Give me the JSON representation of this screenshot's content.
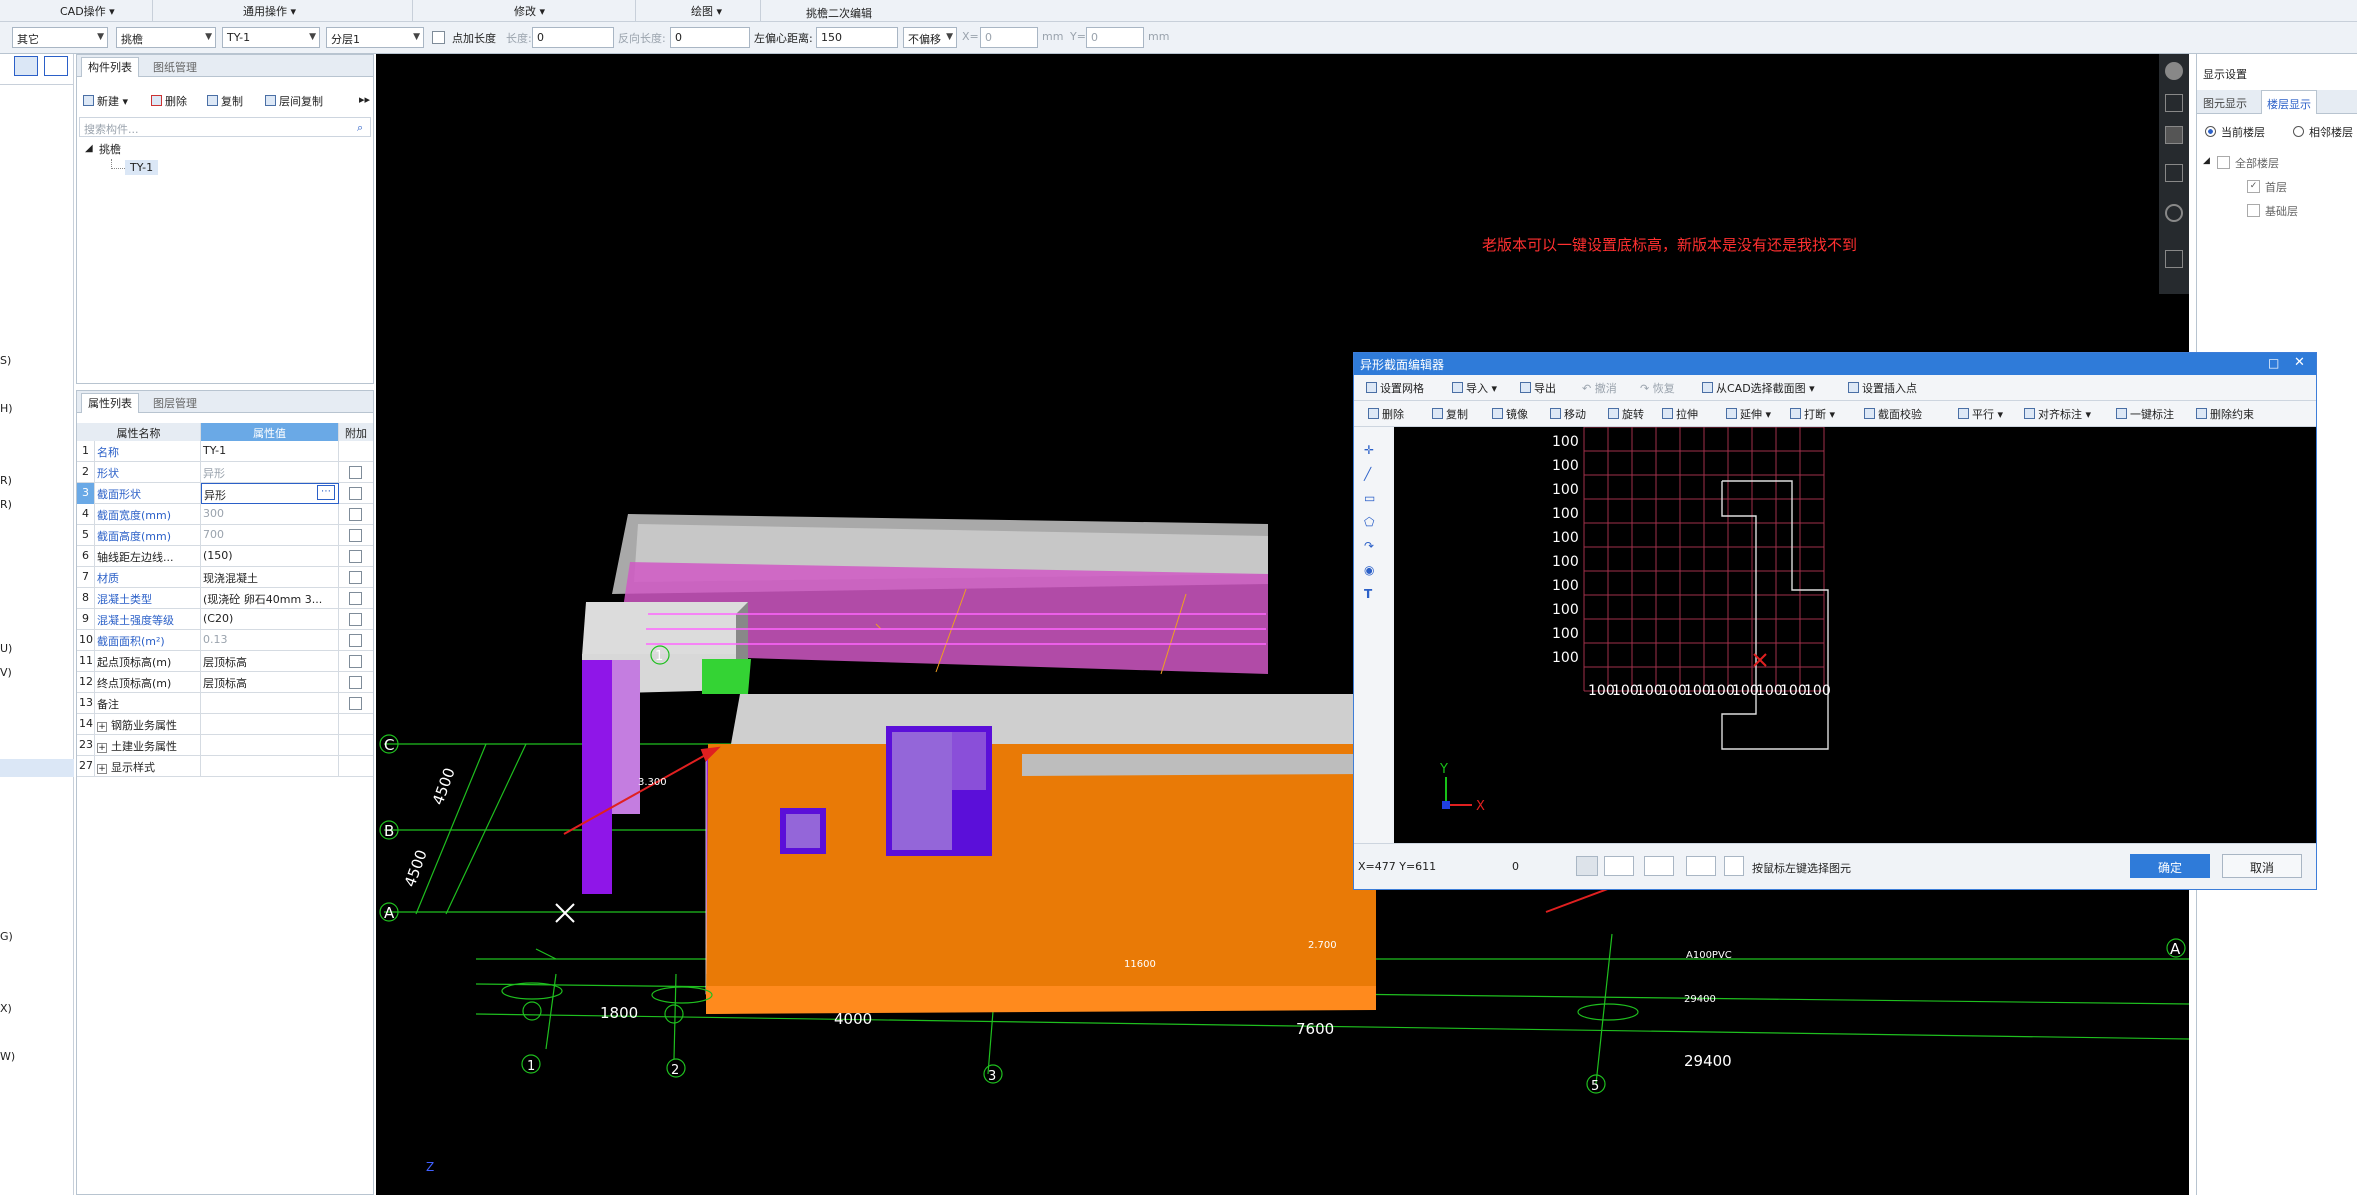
{
  "ribbon": {
    "groups": [
      "CAD操作",
      "通用操作",
      "修改",
      "绘图",
      "挑檐二次编辑"
    ]
  },
  "toolbar": {
    "type_select": "其它",
    "category_select": "挑檐",
    "component_select": "TY-1",
    "layer_select": "分层1",
    "point_length_label": "点加长度",
    "length_label": "长度:",
    "length_value": "0",
    "reverse_length_label": "反向长度:",
    "reverse_length_value": "0",
    "left_offset_label": "左偏心距离:",
    "left_offset_value": "150",
    "offset_mode_select": "不偏移",
    "x_label": "X=",
    "x_value": "0",
    "y_label": "Y=",
    "y_value": "0",
    "unit_mm": "mm"
  },
  "left_strip": {
    "labels": [
      "S)",
      "H)",
      "R)",
      "R)",
      "U)",
      "V)",
      "G)",
      "X)",
      "W)"
    ]
  },
  "component_panel": {
    "tabs": [
      "构件列表",
      "图纸管理"
    ],
    "toolbar": {
      "new": "新建",
      "delete": "删除",
      "copy": "复制",
      "floor_copy": "层间复制"
    },
    "search_placeholder": "搜索构件...",
    "tree": {
      "root": "挑檐",
      "child": "TY-1"
    }
  },
  "property_panel": {
    "tabs": [
      "属性列表",
      "图层管理"
    ],
    "headers": [
      "属性名称",
      "属性值",
      "附加"
    ],
    "rows": [
      {
        "num": "1",
        "name": "名称",
        "value": "TY-1",
        "blue": true,
        "grey": false,
        "check": false
      },
      {
        "num": "2",
        "name": "形状",
        "value": "异形",
        "blue": true,
        "grey": true,
        "check": true
      },
      {
        "num": "3",
        "name": "截面形状",
        "value": "异形",
        "blue": true,
        "grey": false,
        "check": true
      },
      {
        "num": "4",
        "name": "截面宽度(mm)",
        "value": "300",
        "blue": true,
        "grey": true,
        "check": true
      },
      {
        "num": "5",
        "name": "截面高度(mm)",
        "value": "700",
        "blue": true,
        "grey": true,
        "check": true
      },
      {
        "num": "6",
        "name": "轴线距左边线...",
        "value": "(150)",
        "blue": false,
        "grey": false,
        "check": true
      },
      {
        "num": "7",
        "name": "材质",
        "value": "现浇混凝土",
        "blue": true,
        "grey": false,
        "check": true
      },
      {
        "num": "8",
        "name": "混凝土类型",
        "value": "(现浇砼 卵石40mm 3...",
        "blue": true,
        "grey": false,
        "check": true
      },
      {
        "num": "9",
        "name": "混凝土强度等级",
        "value": "(C20)",
        "blue": true,
        "grey": false,
        "check": true
      },
      {
        "num": "10",
        "name": "截面面积(m²)",
        "value": "0.13",
        "blue": true,
        "grey": true,
        "check": true
      },
      {
        "num": "11",
        "name": "起点顶标高(m)",
        "value": "层顶标高",
        "blue": false,
        "grey": false,
        "check": true
      },
      {
        "num": "12",
        "name": "终点顶标高(m)",
        "value": "层顶标高",
        "blue": false,
        "grey": false,
        "check": true
      },
      {
        "num": "13",
        "name": "备注",
        "value": "",
        "blue": false,
        "grey": false,
        "check": true
      },
      {
        "num": "14",
        "name": "钢筋业务属性",
        "value": "",
        "blue": false,
        "grey": false,
        "check": false,
        "expand": true
      },
      {
        "num": "23",
        "name": "土建业务属性",
        "value": "",
        "blue": false,
        "grey": false,
        "check": false,
        "expand": true
      },
      {
        "num": "27",
        "name": "显示样式",
        "value": "",
        "blue": false,
        "grey": false,
        "check": false,
        "expand": true
      }
    ]
  },
  "canvas": {
    "annotation": "老版本可以一键设置底标高，新版本是没有还是我找不到",
    "axis_letters": [
      "C",
      "B",
      "A",
      "A"
    ],
    "axis_numbers": [
      "1",
      "1",
      "2",
      "3",
      "5"
    ],
    "dims": [
      "1800",
      "4000",
      "7600",
      "29400",
      "4500",
      "4500",
      "11600",
      "29400",
      "2.700",
      "3.300",
      "A100PVC"
    ]
  },
  "right_panel": {
    "title": "显示设置",
    "tabs": [
      "图元显示",
      "楼层显示"
    ],
    "radio_current": "当前楼层",
    "radio_adjacent": "相邻楼层",
    "tree": {
      "root": "全部楼层",
      "items": [
        "首层",
        "基础层"
      ]
    },
    "current_floor_checked": true
  },
  "dialog": {
    "title": "异形截面编辑器",
    "toolbar1": {
      "grid": "设置网格",
      "import": "导入",
      "export": "导出",
      "undo": "撤消",
      "redo": "恢复",
      "from_cad": "从CAD选择截面图",
      "insert_point": "设置插入点"
    },
    "toolbar2": {
      "delete": "删除",
      "copy": "复制",
      "mirror": "镜像",
      "move": "移动",
      "rotate": "旋转",
      "stretch": "拉伸",
      "extend": "延伸",
      "break": "打断",
      "check": "截面校验",
      "parallel": "平行",
      "align_dim": "对齐标注",
      "one_key_dim": "一键标注",
      "del_constraint": "删除约束"
    },
    "grid": {
      "row_labels": [
        "100",
        "100",
        "100",
        "100",
        "100",
        "100",
        "100",
        "100",
        "100",
        "100"
      ],
      "col_labels": [
        "100",
        "100",
        "100",
        "100",
        "100",
        "100",
        "100",
        "100",
        "100",
        "100"
      ]
    },
    "axis_x": "X",
    "axis_y": "Y",
    "status": {
      "coords": "X=477 Y=611",
      "value": "0",
      "hint": "按鼠标左键选择图元"
    },
    "ok": "确定",
    "cancel": "取消"
  }
}
